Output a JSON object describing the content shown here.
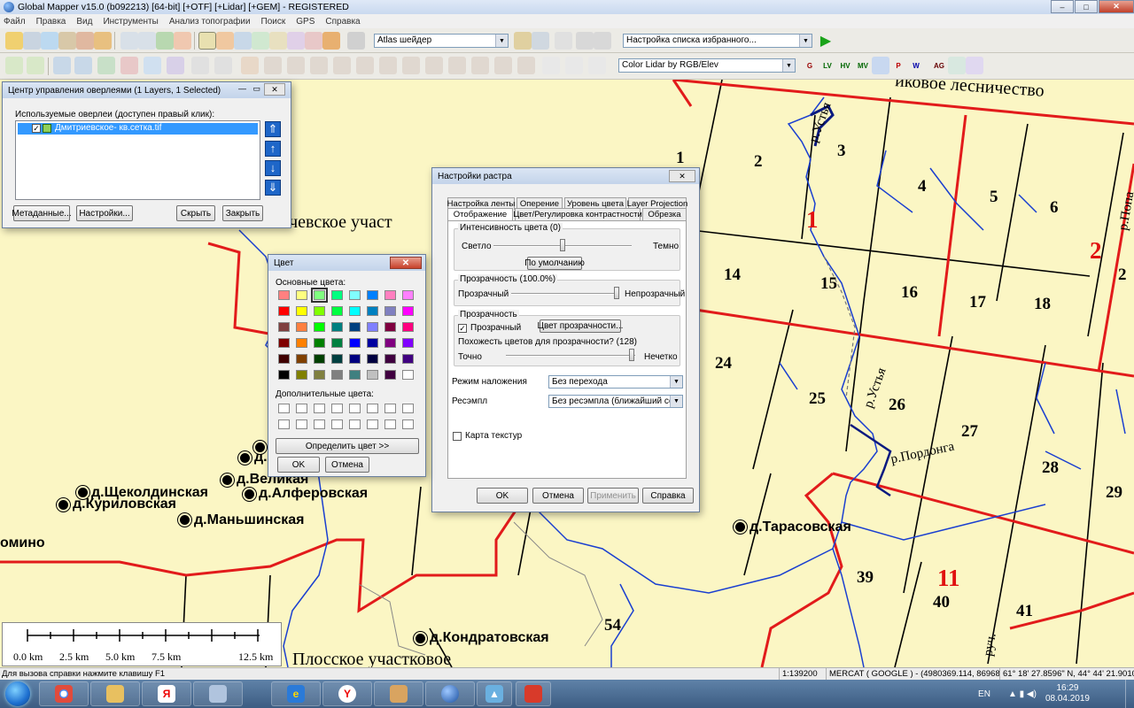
{
  "window": {
    "title": "Global Mapper v15.0 (b092213) [64-bit] [+OTF] [+Lidar] [+GEM] - REGISTERED",
    "minimize": "–",
    "maximize": "□",
    "close": "✕"
  },
  "menu": [
    "Файл",
    "Правка",
    "Вид",
    "Инструменты",
    "Анализ топографии",
    "Поиск",
    "GPS",
    "Справка"
  ],
  "toolbar": {
    "shader_combo": "Atlas шейдер",
    "favorites_combo": "Настройка списка избранного...",
    "lidar_combo": "Color Lidar by RGB/Elev",
    "lidar_btn_labels": [
      "G",
      "LV",
      "HV",
      "MV",
      "P",
      "W",
      "AG"
    ]
  },
  "overlay_panel": {
    "title": "Центр управления оверлеями (1 Layers, 1 Selected)",
    "list_label": "Используемые оверлеи (доступен правый клик):",
    "layer_name": "Дмитриевское- кв.сетка.tif",
    "buttons": [
      "Метаданные...",
      "Настройки...",
      "Скрыть",
      "Закрыть"
    ]
  },
  "color_dialog": {
    "title": "Цвет",
    "basic_label": "Основные цвета:",
    "custom_label": "Дополнительные цвета:",
    "define_button": "Определить цвет >>",
    "ok": "OK",
    "cancel": "Отмена",
    "colors": [
      "#ff8080",
      "#ffff80",
      "#80ff80",
      "#00ff80",
      "#80ffff",
      "#0080ff",
      "#ff80c0",
      "#ff80ff",
      "#ff0000",
      "#ffff00",
      "#80ff00",
      "#00ff40",
      "#00ffff",
      "#0080c0",
      "#8080c0",
      "#ff00ff",
      "#804040",
      "#ff8040",
      "#00ff00",
      "#008080",
      "#004080",
      "#8080ff",
      "#800040",
      "#ff0080",
      "#800000",
      "#ff8000",
      "#008000",
      "#008040",
      "#0000ff",
      "#0000a0",
      "#800080",
      "#8000ff",
      "#400000",
      "#804000",
      "#004000",
      "#004040",
      "#000080",
      "#000040",
      "#400040",
      "#400080",
      "#000000",
      "#808000",
      "#808040",
      "#808080",
      "#408080",
      "#c0c0c0",
      "#400040",
      "#ffffff"
    ],
    "selected_index": 2
  },
  "raster_dialog": {
    "title": "Настройки растра",
    "tabs_row1": [
      "Настройка ленты",
      "Оперение",
      "Уровень цвета",
      "Layer Projection"
    ],
    "tabs_row2": [
      "Отображение",
      "Цвет/Регулировка контрастности",
      "Обрезка"
    ],
    "intensity_group": "Интенсивность цвета (0)",
    "light": "Светло",
    "dark": "Темно",
    "default_button": "По умолчанию",
    "transparency_group": "Прозрачность (100.0%)",
    "transparent_label": "Прозрачный",
    "opaque_label": "Непрозрачный",
    "transparency2_group": "Прозрачность",
    "transparent_check": "Прозрачный",
    "transparent_color_button": "Цвет прозрачности...",
    "similarity_label": "Похожесть цветов для прозрачности? (128)",
    "exact": "Точно",
    "fuzzy": "Нечетко",
    "blend_label": "Режим наложения",
    "blend_value": "Без перехода",
    "resample_label": "Ресэмпл",
    "resample_value": "Без ресэмпла (ближайший сосед)",
    "texture_label": "Карта текстур",
    "buttons": [
      "OK",
      "Отмена",
      "Применить",
      "Справка"
    ],
    "intensity_level": 0.5,
    "transparency_level": 1.0,
    "similarity_level": 0.99
  },
  "map": {
    "forestry_label": "иковое лесничество",
    "uchastok_label": "ачевское участ",
    "ploskoe_label": "Плосское участковое",
    "river_labels": [
      "р.Устья",
      "р.Устья",
      "р.Пордонга",
      "р.Попа",
      "руч."
    ],
    "quarters": [
      "1",
      "2",
      "3",
      "4",
      "5",
      "6",
      "14",
      "15",
      "16",
      "17",
      "18",
      "24",
      "25",
      "26",
      "27",
      "28",
      "29",
      "39",
      "40",
      "41",
      "54"
    ],
    "red_numbers": [
      "1",
      "2",
      "11"
    ],
    "villages": [
      "д.Щеколдинская",
      "д.Куриловская",
      "д.Великая",
      "д.Алферовская",
      "д.Маньшинская",
      "д.Тарасовская",
      "д.Кондратовская",
      "д.",
      "омино"
    ]
  },
  "scale": {
    "labels": [
      "0.0 km",
      "2.5 km",
      "5.0 km",
      "7.5 km",
      "12.5 km"
    ]
  },
  "status": {
    "help": "Для вызова справки нажмите клавишу F1",
    "scale": "1:139200",
    "projection": "MERCAT ( GOOGLE ) - (4980369.114, 8696829.507 )",
    "coords": "61° 18' 27.8596\" N, 44° 44' 21.9010\" E"
  },
  "taskbar": {
    "lang": "EN",
    "time": "16:29",
    "date": "08.04.2019",
    "apps": [
      "chrome",
      "explorer",
      "yandex",
      "monitor",
      "ie",
      "yandex-browser",
      "folder",
      "paint",
      "globe",
      "delta",
      "global-mapper"
    ]
  }
}
